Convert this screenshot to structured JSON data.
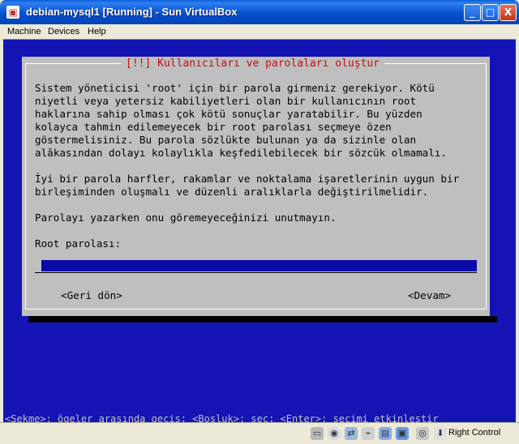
{
  "window": {
    "title": "debian-mysql1 [Running] - Sun VirtualBox",
    "buttons": {
      "minimize": "_",
      "maximize": "□",
      "close": "X"
    }
  },
  "menubar": {
    "items": [
      "Machine",
      "Devices",
      "Help"
    ]
  },
  "dialog": {
    "title": "[!!] Kullanıcıları ve parolaları oluştur",
    "paragraphs": [
      "Sistem yöneticisi 'root' için bir parola girmeniz gerekiyor. Kötü",
      "niyetli veya yetersiz kabiliyetleri olan bir kullanıcının root",
      "haklarına sahip olması çok kötü sonuçlar yaratabilir. Bu yüzden",
      "kolayca tahmin edilemeyecek bir root parolası seçmeye özen",
      "göstermelisiniz. Bu parola sözlükte bulunan ya da sizinle olan",
      "alâkasından dolayı kolaylıkla keşfedilebilecek bir sözcük olmamalı."
    ],
    "paragraph2": [
      "İyi bir parola harfler, rakamlar ve noktalama işaretlerinin uygun bir",
      "birleşiminden oluşmalı ve düzenli aralıklarla değiştirilmelidir."
    ],
    "paragraph3": "Parolayı yazarken onu göremeyeceğinizi unutmayın.",
    "field_label": "Root parolası:",
    "field_value": "",
    "back_button": "<Geri dön>",
    "continue_button": "<Devam>"
  },
  "help_line": "<Sekme>: ögeler arasında geçiş; <Boşluk>: seç; <Enter>: seçimi etkinleştir",
  "statusbar": {
    "icons": [
      "hard-disk-icon",
      "cd-icon",
      "network-icon",
      "usb-icon",
      "shared-folder-icon",
      "display-icon",
      "virtualization-icon",
      "mouse-integration-icon",
      "host-key-icon"
    ],
    "host_key": "Right Control"
  }
}
